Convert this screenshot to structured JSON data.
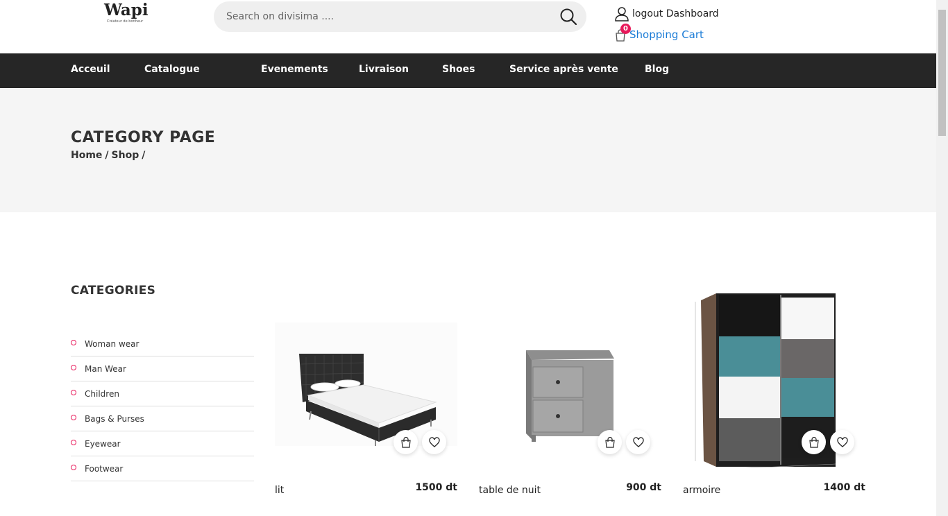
{
  "header": {
    "logo_text": "Wapi",
    "logo_tagline": "Créateur de bonheur",
    "search_placeholder": "Search on divisima ....",
    "account_label": "logout Dashboard",
    "cart_label": "Shopping Cart",
    "cart_count": "0"
  },
  "nav": {
    "items": [
      {
        "label": "Acceuil"
      },
      {
        "label": "Catalogue"
      },
      {
        "label": "Evenements"
      },
      {
        "label": "Livraison"
      },
      {
        "label": "Shoes"
      },
      {
        "label": "Service après vente"
      },
      {
        "label": "Blog"
      }
    ]
  },
  "banner": {
    "title": "CATEGORY PAGE",
    "breadcrumb": [
      "Home",
      "/",
      "Shop",
      "/"
    ]
  },
  "sidebar": {
    "title": "CATEGORIES",
    "items": [
      {
        "label": "Woman wear"
      },
      {
        "label": "Man Wear"
      },
      {
        "label": "Children"
      },
      {
        "label": "Bags & Purses"
      },
      {
        "label": "Eyewear"
      },
      {
        "label": "Footwear"
      }
    ]
  },
  "products": [
    {
      "name": "lit",
      "price": "1500 dt",
      "image_icon": "bed-image"
    },
    {
      "name": "table de nuit",
      "price": "900 dt",
      "image_icon": "nightstand-image"
    },
    {
      "name": "armoire",
      "price": "1400 dt",
      "image_icon": "wardrobe-image"
    }
  ],
  "colors": {
    "accent": "#e8195a",
    "nav_bg": "#262626",
    "link": "#1a7bd6",
    "banner_bg": "#f5f5f5"
  }
}
